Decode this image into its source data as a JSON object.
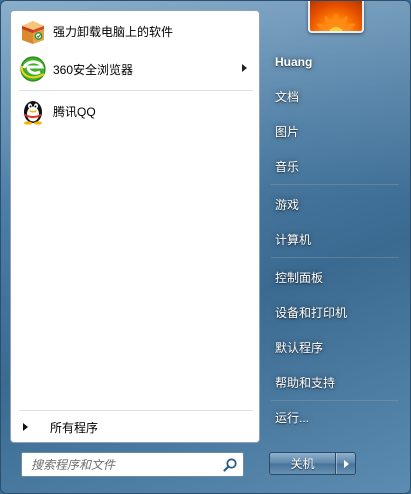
{
  "pinned": [
    {
      "label": "强力卸载电脑上的软件",
      "icon": "uninstall-box-icon",
      "has_submenu": false
    },
    {
      "label": "360安全浏览器",
      "icon": "360-browser-icon",
      "has_submenu": true
    },
    {
      "label": "腾讯QQ",
      "icon": "qq-penguin-icon",
      "has_submenu": false
    }
  ],
  "all_programs": {
    "label": "所有程序"
  },
  "search": {
    "placeholder": "搜索程序和文件",
    "icon": "search-icon"
  },
  "user": {
    "name": "Huang",
    "picture_icon": "flower-avatar-icon"
  },
  "right_links": {
    "documents": "文档",
    "pictures": "图片",
    "music": "音乐",
    "games": "游戏",
    "computer": "计算机",
    "control_panel": "控制面板",
    "devices_printers": "设备和打印机",
    "default_programs": "默认程序",
    "help_support": "帮助和支持",
    "run": "运行..."
  },
  "shutdown": {
    "label": "关机",
    "more_icon": "chevron-right-icon"
  },
  "colors": {
    "frame": "#4a7ba3",
    "pane": "#ffffff",
    "text_right": "#ffffff"
  }
}
